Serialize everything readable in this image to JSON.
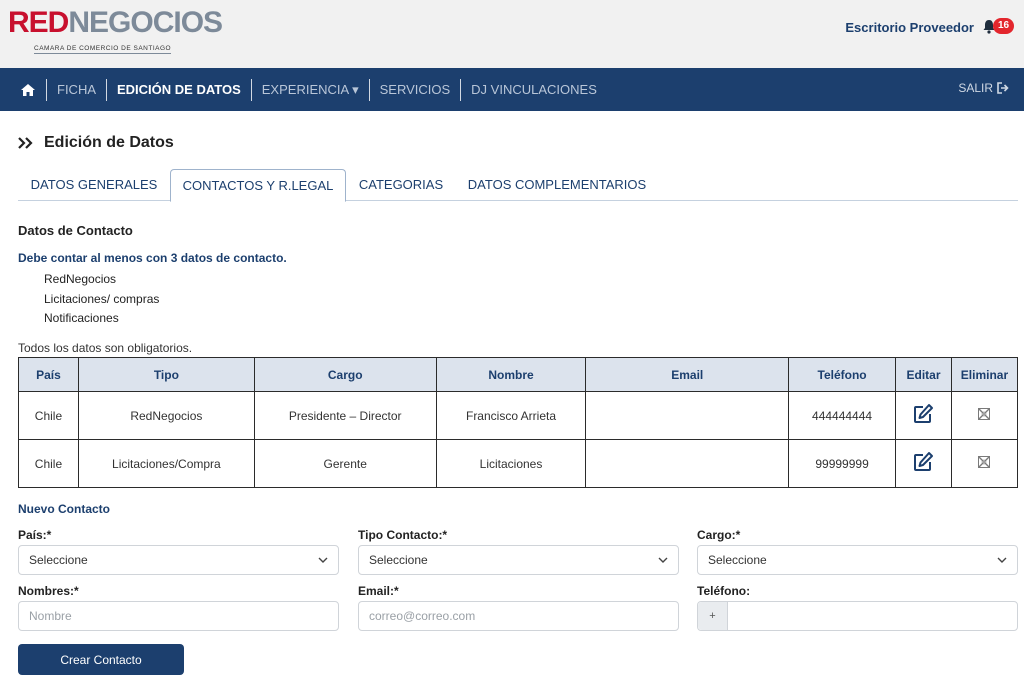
{
  "header": {
    "logo_red": "RED",
    "logo_gray": "NEGOCIOS",
    "logo_sub": "CAMARA DE COMERCIO DE SANTIAGO",
    "escritorio": "Escritorio Proveedor",
    "notif_count": "16"
  },
  "nav": {
    "items": [
      "FICHA",
      "EDICIÓN DE DATOS",
      "EXPERIENCIA ▾",
      "SERVICIOS",
      "DJ VINCULACIONES"
    ],
    "active": "EDICIÓN DE DATOS",
    "logout": "SALIR"
  },
  "page": {
    "title": "Edición de Datos"
  },
  "tabs": [
    "DATOS GENERALES",
    "CONTACTOS Y R.LEGAL",
    "CATEGORIAS",
    "DATOS COMPLEMENTARIOS"
  ],
  "contact": {
    "section_title": "Datos de Contacto",
    "must_text": "Debe contar al menos con 3 datos de contacto.",
    "required_types": [
      "RedNegocios",
      "Licitaciones/ compras",
      "Notificaciones"
    ],
    "note": "Todos los datos son obligatorios."
  },
  "table": {
    "headers": [
      "País",
      "Tipo",
      "Cargo",
      "Nombre",
      "Email",
      "Teléfono",
      "Editar",
      "Eliminar"
    ],
    "rows": [
      [
        "Chile",
        "RedNegocios",
        "Presidente – Director",
        "Francisco Arrieta",
        "",
        "444444444"
      ],
      [
        "Chile",
        "Licitaciones/Compra",
        "Gerente",
        "Licitaciones",
        "",
        "99999999"
      ]
    ]
  },
  "form": {
    "title": "Nuevo Contacto",
    "pais_label": "País:*",
    "tipo_label": "Tipo Contacto:*",
    "cargo_label": "Cargo:*",
    "select_value": "Seleccione",
    "nombres_label": "Nombres:*",
    "nombres_placeholder": "Nombre",
    "email_label": "Email:*",
    "email_placeholder": "correo@correo.com",
    "telefono_label": "Teléfono:",
    "telefono_prefix": "+",
    "create_button": "Crear Contacto"
  },
  "colors": {
    "navy": "#1c3f6e",
    "red": "#c8102e",
    "badge": "#e3262d"
  }
}
